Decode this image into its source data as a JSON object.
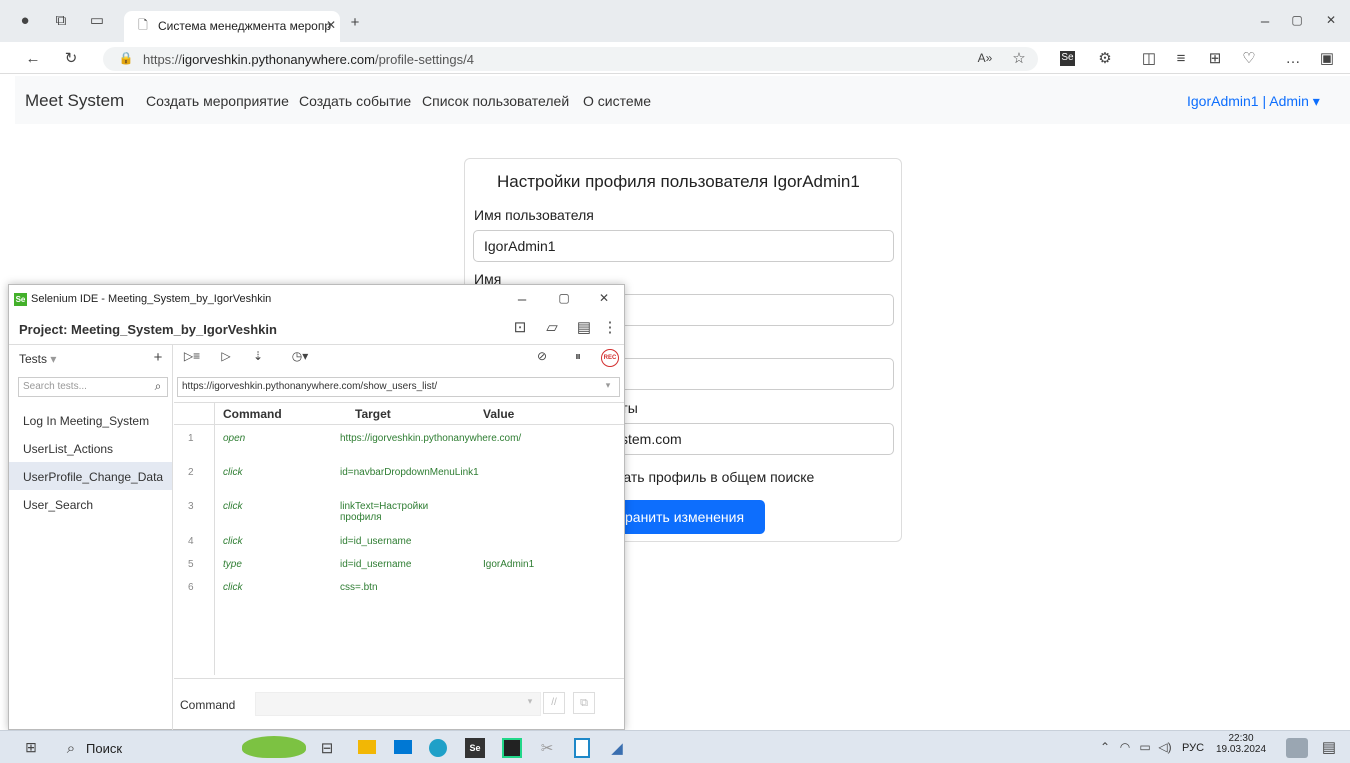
{
  "browser": {
    "tab_title": "Система менеджмента меропр",
    "url_prefix": "https://",
    "url_host": "igorveshkin.pythonanywhere.com",
    "url_path": "/profile-settings/4"
  },
  "site": {
    "brand": "Meet System",
    "nav": [
      "Создать мероприятие",
      "Создать событие",
      "Список пользователей",
      "О системе"
    ],
    "user_menu": "IgorAdmin1 | Admin ▾"
  },
  "form": {
    "title": "Настройки профиля пользователя IgorAdmin1",
    "username_label": "Имя пользователя",
    "username_value": "IgorAdmin1",
    "name_label": "Имя",
    "email_label_partial": "чты",
    "email_value_partial": "ystem.com",
    "checkbox_label_partial": "жать профиль в общем поиске",
    "save_label": "хранить изменения"
  },
  "selenium": {
    "window_title": "Selenium IDE - Meeting_System_by_IgorVeshkin",
    "project": "Project:  Meeting_System_by_IgorVeshkin",
    "tests_label": "Tests",
    "search_placeholder": "Search tests...",
    "base_url": "https://igorveshkin.pythonanywhere.com/show_users_list/",
    "tests": [
      "Log In Meeting_System",
      "UserList_Actions",
      "UserProfile_Change_Data",
      "User_Search"
    ],
    "selected_test": "UserProfile_Change_Data",
    "columns": [
      "Command",
      "Target",
      "Value"
    ],
    "rows": [
      {
        "n": "1",
        "command": "open",
        "target": "https://igorveshkin.pythonanywhere.com/",
        "value": ""
      },
      {
        "n": "2",
        "command": "click",
        "target": "id=navbarDropdownMenuLink1",
        "value": ""
      },
      {
        "n": "3",
        "command": "click",
        "target": "linkText=Настройки профиля",
        "value": ""
      },
      {
        "n": "4",
        "command": "click",
        "target": "id=id_username",
        "value": ""
      },
      {
        "n": "5",
        "command": "type",
        "target": "id=id_username",
        "value": "IgorAdmin1"
      },
      {
        "n": "6",
        "command": "click",
        "target": "css=.btn",
        "value": ""
      }
    ],
    "command_label": "Command"
  },
  "taskbar": {
    "search": "Поиск",
    "lang": "РУС",
    "time": "22:30",
    "date": "19.03.2024"
  }
}
